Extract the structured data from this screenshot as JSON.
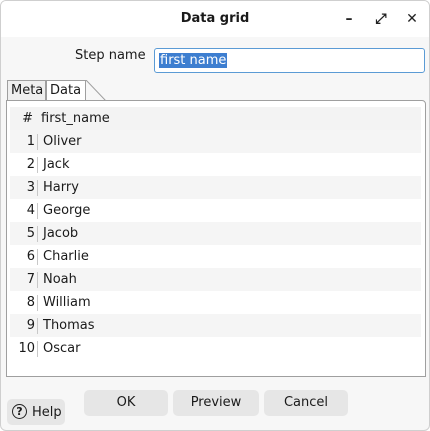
{
  "window": {
    "title": "Data grid",
    "minimize_glyph": "–",
    "maximize_glyph": "⤢",
    "close_glyph": "✕"
  },
  "step_name": {
    "label": "Step name",
    "value": "first name"
  },
  "tabs": [
    {
      "label": "Meta",
      "active": false
    },
    {
      "label": "Data",
      "active": true
    }
  ],
  "grid": {
    "headers": [
      "#",
      "first_name"
    ],
    "rows": [
      {
        "num": "1",
        "value": "Oliver"
      },
      {
        "num": "2",
        "value": "Jack"
      },
      {
        "num": "3",
        "value": "Harry"
      },
      {
        "num": "4",
        "value": "George"
      },
      {
        "num": "5",
        "value": "Jacob"
      },
      {
        "num": "6",
        "value": "Charlie"
      },
      {
        "num": "7",
        "value": "Noah"
      },
      {
        "num": "8",
        "value": "William"
      },
      {
        "num": "9",
        "value": "Thomas"
      },
      {
        "num": "10",
        "value": "Oscar"
      }
    ]
  },
  "buttons": {
    "help": "Help",
    "ok": "OK",
    "preview": "Preview",
    "cancel": "Cancel"
  },
  "icons": {
    "help": "question-circle-icon"
  },
  "colors": {
    "selection": "#3d7ed0",
    "focus_border": "#5b9bd5"
  }
}
